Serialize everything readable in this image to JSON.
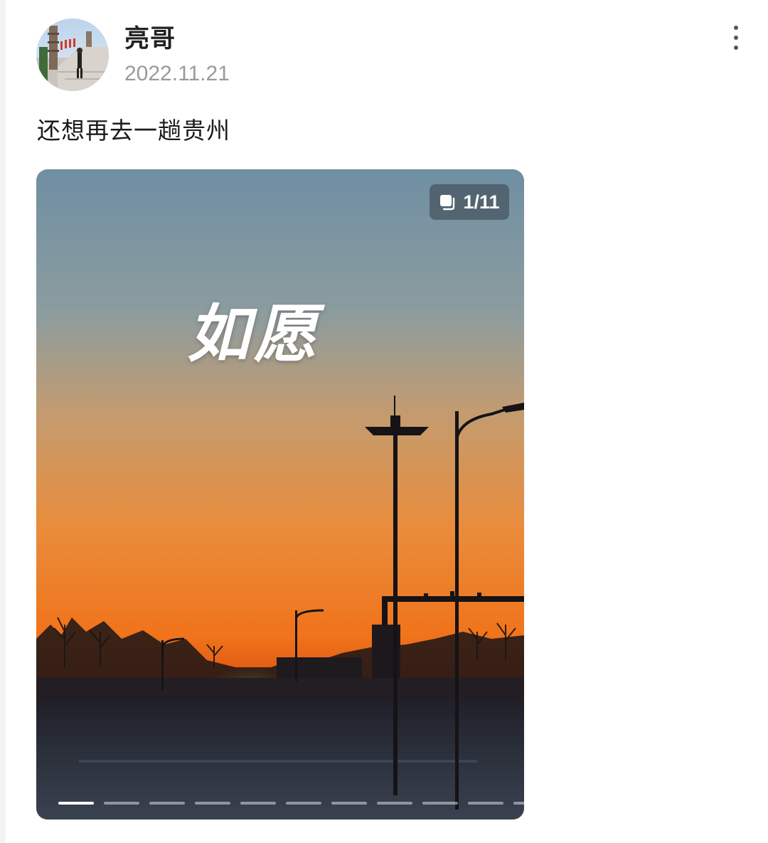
{
  "post": {
    "author": "亮哥",
    "date": "2022.11.21",
    "text": "还想再去一趟贵州",
    "more_icon": "more-vertical-icon"
  },
  "photo": {
    "caption": "如愿",
    "page_counter": "1/11",
    "current_page": 1,
    "total_pages": 11,
    "gallery_icon": "multiple-images-icon"
  },
  "colors": {
    "author_text": "#222222",
    "date_text": "#9a9a9a",
    "sky_top": "#6e8fa3",
    "sky_horizon": "#f07a20"
  }
}
